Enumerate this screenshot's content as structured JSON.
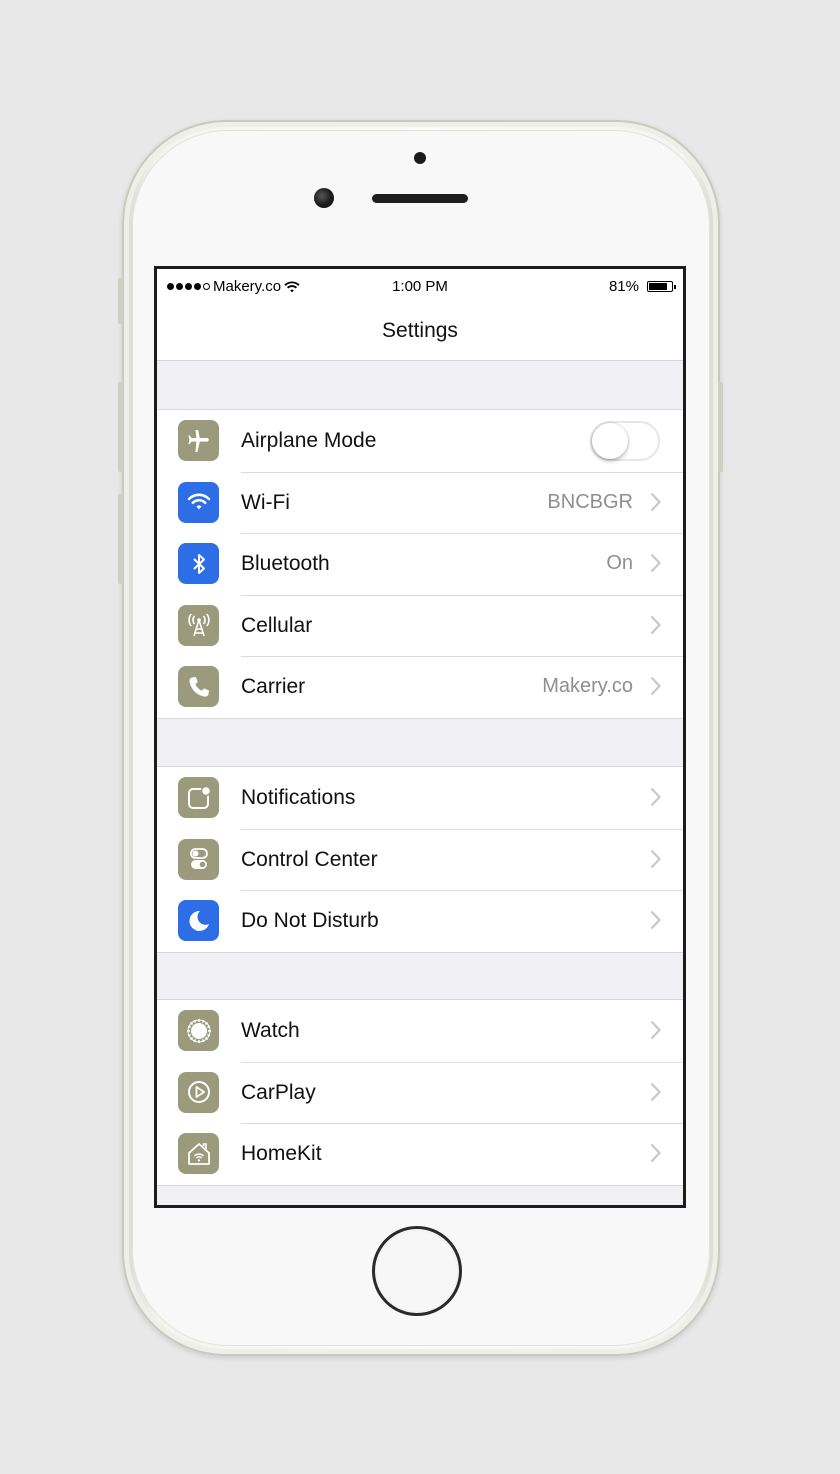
{
  "status_bar": {
    "signal_dots_filled": 4,
    "signal_dots_total": 5,
    "carrier": "Makery.co",
    "time": "1:00 PM",
    "battery_percent": "81%",
    "battery_level": 0.81
  },
  "nav": {
    "title": "Settings"
  },
  "colors": {
    "olive_icon": "#9b9a7c",
    "blue_icon": "#2d6ee6",
    "chevron": "#c7c7cc",
    "value_text": "#8e8e93"
  },
  "groups": [
    {
      "items": [
        {
          "label": "Airplane Mode",
          "icon": "airplane-icon",
          "toggle_on": false
        },
        {
          "label": "Wi-Fi",
          "icon": "wifi-icon",
          "value": "BNCBGR"
        },
        {
          "label": "Bluetooth",
          "icon": "bluetooth-icon",
          "value": "On"
        },
        {
          "label": "Cellular",
          "icon": "cellular-antenna-icon",
          "value": ""
        },
        {
          "label": "Carrier",
          "icon": "phone-icon",
          "value": "Makery.co"
        }
      ]
    },
    {
      "items": [
        {
          "label": "Notifications",
          "icon": "notifications-icon",
          "value": ""
        },
        {
          "label": "Control Center",
          "icon": "control-center-icon",
          "value": ""
        },
        {
          "label": "Do Not Disturb",
          "icon": "moon-icon",
          "value": ""
        }
      ]
    },
    {
      "items": [
        {
          "label": "Watch",
          "icon": "watch-icon",
          "value": ""
        },
        {
          "label": "CarPlay",
          "icon": "carplay-icon",
          "value": ""
        },
        {
          "label": "HomeKit",
          "icon": "homekit-icon",
          "value": ""
        }
      ]
    }
  ]
}
